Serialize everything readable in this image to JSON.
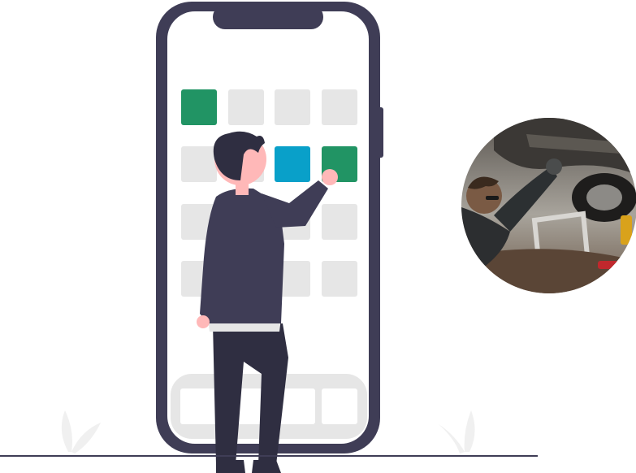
{
  "illustration": {
    "subject": "person-tapping-phone-app-grid",
    "colors": {
      "phone_frame": "#3f3d56",
      "screen": "#ffffff",
      "tile_inactive": "#e6e6e6",
      "tile_active_green": "#219464",
      "tile_active_blue": "#09a0c9",
      "skin": "#ffb8b8",
      "shirt": "#2f2e41",
      "hair": "#2f2e41",
      "pants": "#2f2e41",
      "ground_line": "#3f3d56",
      "plant": "#f0f0f0"
    }
  },
  "photo": {
    "subject": "mechanic-under-car",
    "shape": "circle"
  }
}
